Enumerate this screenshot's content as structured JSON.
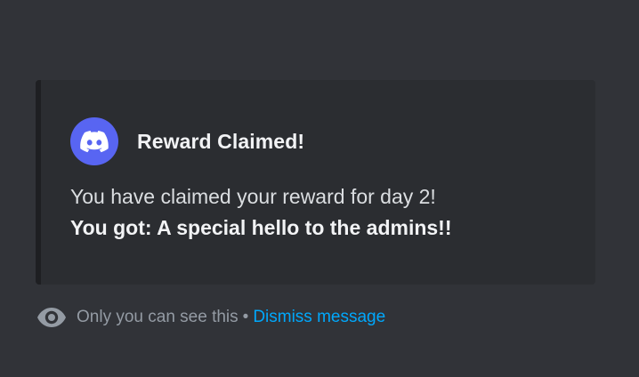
{
  "embed": {
    "title": "Reward Claimed!",
    "line1": "You have claimed your reward for day 2!",
    "line2": "You got: A special hello to the admins!!",
    "avatar_icon": "discord-logo-icon",
    "avatar_color": "#5865f2"
  },
  "ephemeral": {
    "icon": "eye-icon",
    "notice": "Only you can see this",
    "separator": "•",
    "dismiss_label": "Dismiss message",
    "link_color": "#00a8fc"
  }
}
